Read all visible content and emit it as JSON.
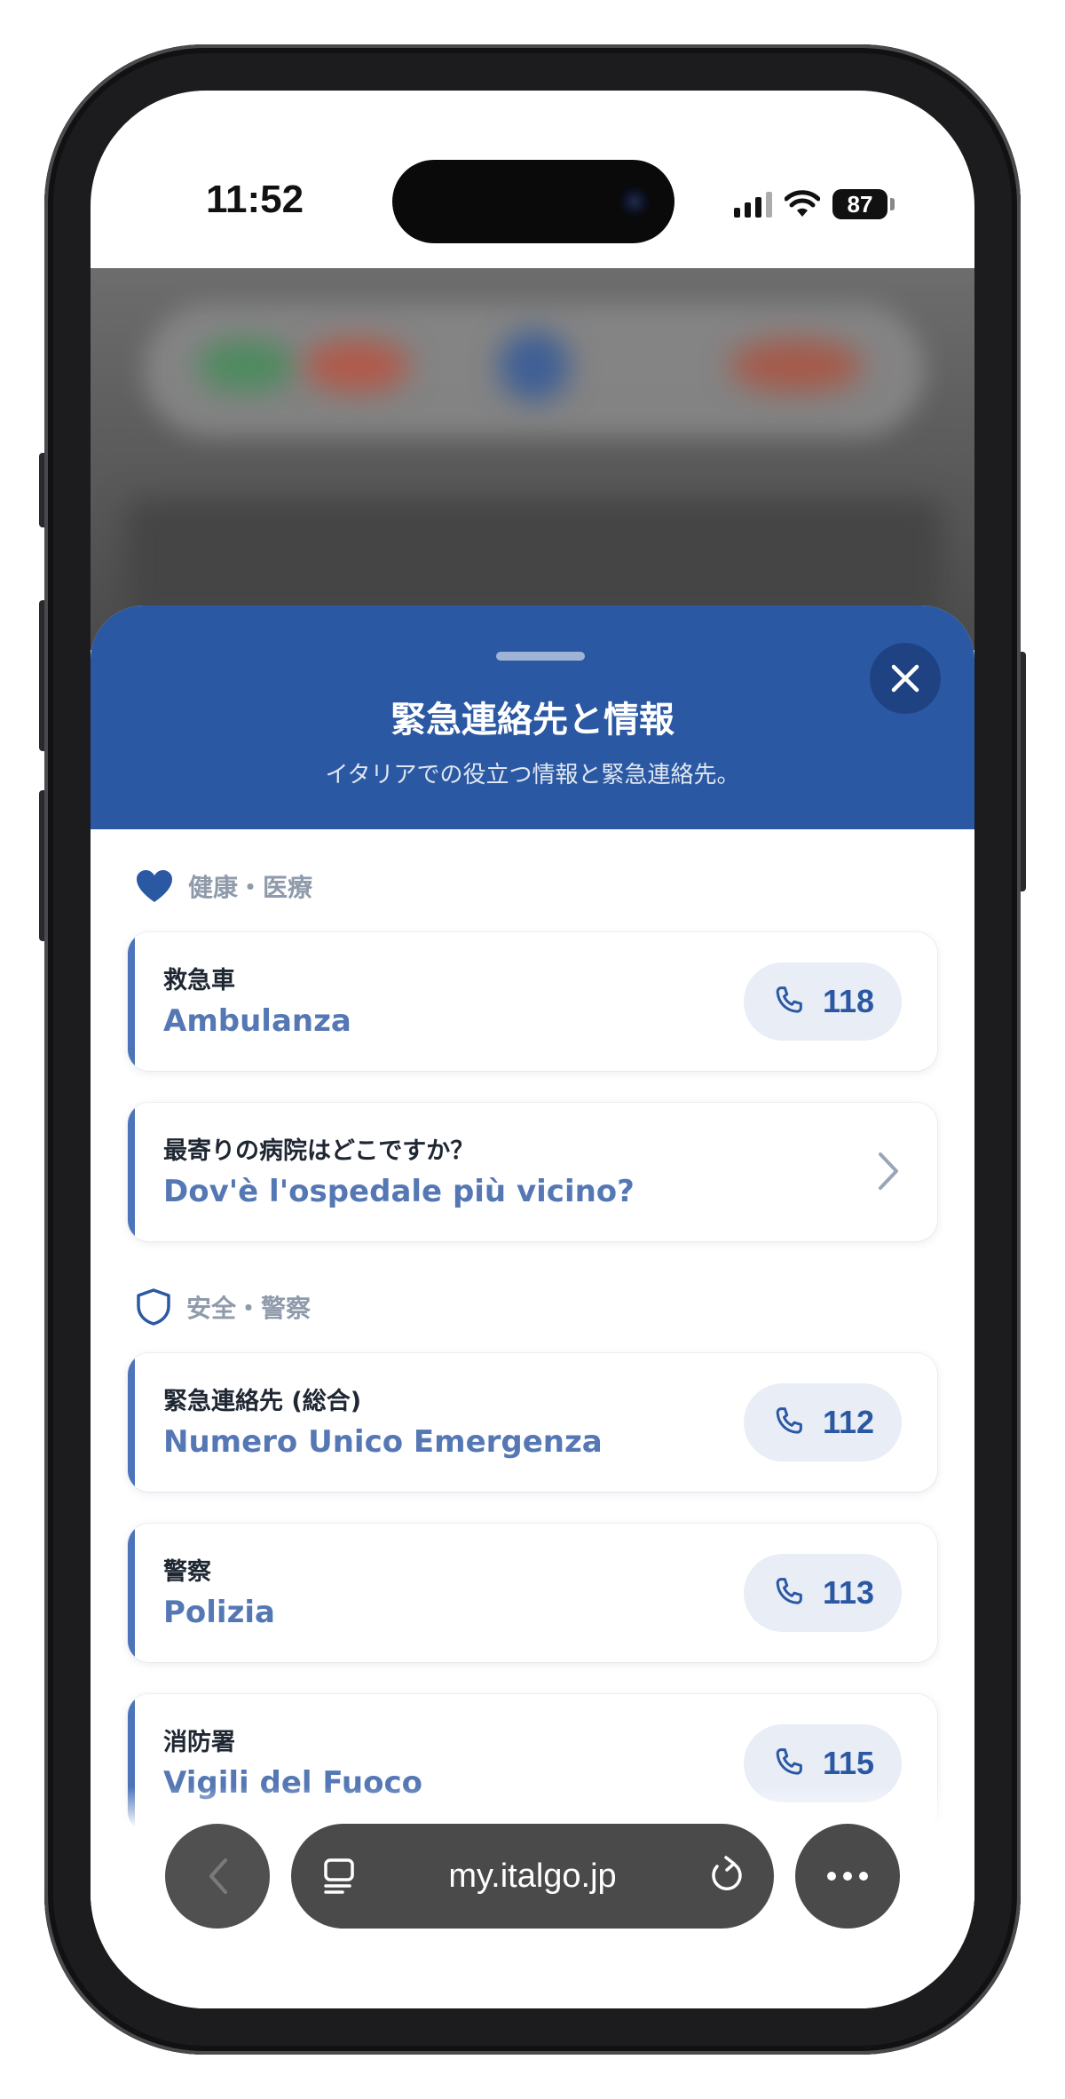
{
  "status_bar": {
    "time": "11:52",
    "battery": "87"
  },
  "sheet": {
    "title": "緊急連絡先と情報",
    "subtitle": "イタリアでの役立つ情報と緊急連絡先。"
  },
  "sections": [
    {
      "label": "健康・医療",
      "icon": "heart-icon",
      "items": [
        {
          "ja": "救急車",
          "it": "Ambulanza",
          "number": "118"
        },
        {
          "ja": "最寄りの病院はどこですか？",
          "it": "Dov'è l'ospedale più vicino?"
        }
      ]
    },
    {
      "label": "安全・警察",
      "icon": "shield-icon",
      "items": [
        {
          "ja": "緊急連絡先 (総合)",
          "it": "Numero Unico Emergenza",
          "number": "112"
        },
        {
          "ja": "警察",
          "it": "Polizia",
          "number": "113"
        },
        {
          "ja": "消防署",
          "it": "Vigili del Fuoco",
          "number": "115"
        }
      ]
    }
  ],
  "browser": {
    "url": "my.italgo.jp"
  },
  "colors": {
    "header_bg": "#2b58a3",
    "accent": "#4c74ba",
    "italian_text": "#5578b5",
    "call_pill": "#e8edf6"
  }
}
